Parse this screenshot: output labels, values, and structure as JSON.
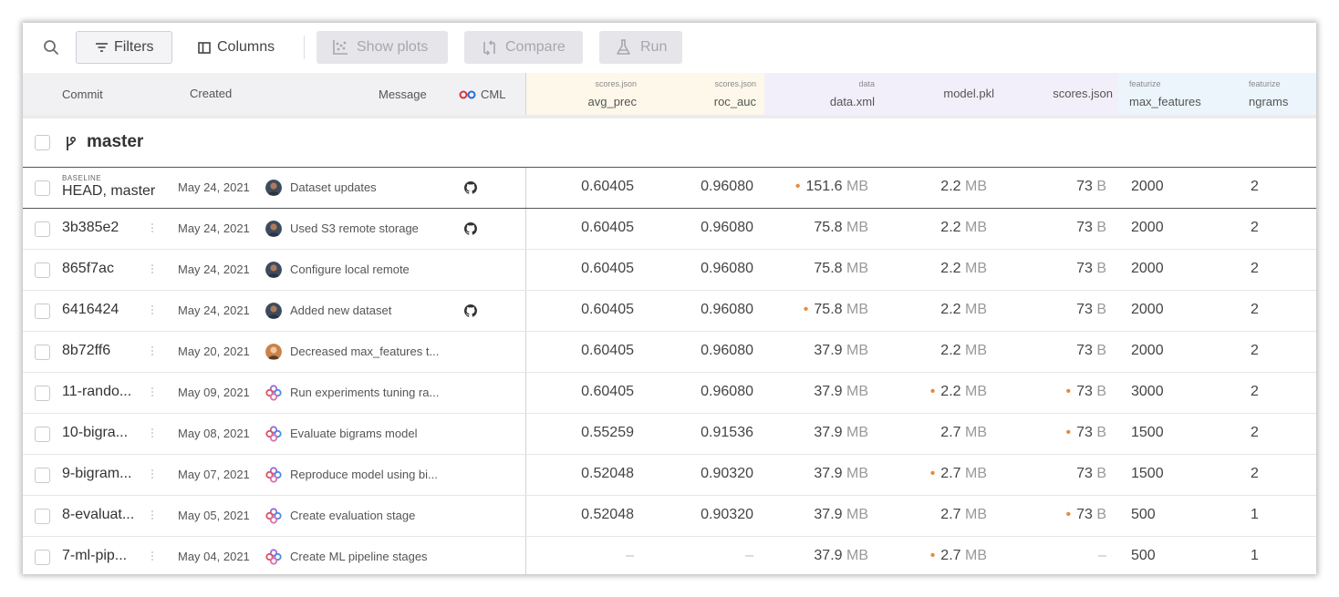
{
  "toolbar": {
    "filters_label": "Filters",
    "columns_label": "Columns",
    "show_plots_label": "Show plots",
    "compare_label": "Compare",
    "run_label": "Run"
  },
  "header": {
    "commit": "Commit",
    "created": "Created",
    "message": "Message",
    "cml": "CML",
    "avg_prec": {
      "source": "scores.json",
      "name": "avg_prec"
    },
    "roc_auc": {
      "source": "scores.json",
      "name": "roc_auc"
    },
    "data_xml": {
      "source": "data",
      "name": "data.xml"
    },
    "model_pkl": {
      "name": "model.pkl"
    },
    "scores_json": {
      "name": "scores.json"
    },
    "max_features": {
      "source": "featurize",
      "name": "max_features"
    },
    "ngrams": {
      "source": "featurize",
      "name": "ngrams"
    }
  },
  "branch": {
    "name": "master",
    "icon": "git-branch-icon"
  },
  "rows": [
    {
      "tag": "BASELINE",
      "commit": "HEAD, master",
      "created": "May 24, 2021",
      "avatar": "user-photo",
      "message": "Dataset updates",
      "cml": true,
      "avg_prec": "0.60405",
      "roc_auc": "0.96080",
      "data_xml": {
        "value": "151.6",
        "unit": "MB",
        "modified": true
      },
      "model_pkl": {
        "value": "2.2",
        "unit": "MB",
        "modified": false
      },
      "scores_json": {
        "value": "73",
        "unit": "B",
        "modified": false
      },
      "max_features": "2000",
      "ngrams": "2"
    },
    {
      "commit": "3b385e2",
      "created": "May 24, 2021",
      "avatar": "user-photo",
      "message": "Used S3 remote storage",
      "cml": true,
      "avg_prec": "0.60405",
      "roc_auc": "0.96080",
      "data_xml": {
        "value": "75.8",
        "unit": "MB",
        "modified": false
      },
      "model_pkl": {
        "value": "2.2",
        "unit": "MB",
        "modified": false
      },
      "scores_json": {
        "value": "73",
        "unit": "B",
        "modified": false
      },
      "max_features": "2000",
      "ngrams": "2"
    },
    {
      "commit": "865f7ac",
      "created": "May 24, 2021",
      "avatar": "user-photo",
      "message": "Configure local remote",
      "cml": false,
      "avg_prec": "0.60405",
      "roc_auc": "0.96080",
      "data_xml": {
        "value": "75.8",
        "unit": "MB",
        "modified": false
      },
      "model_pkl": {
        "value": "2.2",
        "unit": "MB",
        "modified": false
      },
      "scores_json": {
        "value": "73",
        "unit": "B",
        "modified": false
      },
      "max_features": "2000",
      "ngrams": "2"
    },
    {
      "commit": "6416424",
      "created": "May 24, 2021",
      "avatar": "user-photo",
      "message": "Added new dataset",
      "cml": true,
      "avg_prec": "0.60405",
      "roc_auc": "0.96080",
      "data_xml": {
        "value": "75.8",
        "unit": "MB",
        "modified": true
      },
      "model_pkl": {
        "value": "2.2",
        "unit": "MB",
        "modified": false
      },
      "scores_json": {
        "value": "73",
        "unit": "B",
        "modified": false
      },
      "max_features": "2000",
      "ngrams": "2"
    },
    {
      "commit": "8b72ff6",
      "created": "May 20, 2021",
      "avatar": "user-photo-2",
      "message": "Decreased max_features t...",
      "cml": false,
      "avg_prec": "0.60405",
      "roc_auc": "0.96080",
      "data_xml": {
        "value": "37.9",
        "unit": "MB",
        "modified": false
      },
      "model_pkl": {
        "value": "2.2",
        "unit": "MB",
        "modified": false
      },
      "scores_json": {
        "value": "73",
        "unit": "B",
        "modified": false
      },
      "max_features": "2000",
      "ngrams": "2"
    },
    {
      "commit": "11-rando...",
      "created": "May 09, 2021",
      "avatar": "dvc-bot",
      "message": "Run experiments tuning ra...",
      "cml": false,
      "avg_prec": "0.60405",
      "roc_auc": "0.96080",
      "data_xml": {
        "value": "37.9",
        "unit": "MB",
        "modified": false
      },
      "model_pkl": {
        "value": "2.2",
        "unit": "MB",
        "modified": true
      },
      "scores_json": {
        "value": "73",
        "unit": "B",
        "modified": true
      },
      "max_features": "3000",
      "ngrams": "2"
    },
    {
      "commit": "10-bigra...",
      "created": "May 08, 2021",
      "avatar": "dvc-bot",
      "message": "Evaluate bigrams model",
      "cml": false,
      "avg_prec": "0.55259",
      "roc_auc": "0.91536",
      "data_xml": {
        "value": "37.9",
        "unit": "MB",
        "modified": false
      },
      "model_pkl": {
        "value": "2.7",
        "unit": "MB",
        "modified": false
      },
      "scores_json": {
        "value": "73",
        "unit": "B",
        "modified": true
      },
      "max_features": "1500",
      "ngrams": "2"
    },
    {
      "commit": "9-bigram...",
      "created": "May 07, 2021",
      "avatar": "dvc-bot",
      "message": "Reproduce model using bi...",
      "cml": false,
      "avg_prec": "0.52048",
      "roc_auc": "0.90320",
      "data_xml": {
        "value": "37.9",
        "unit": "MB",
        "modified": false
      },
      "model_pkl": {
        "value": "2.7",
        "unit": "MB",
        "modified": true
      },
      "scores_json": {
        "value": "73",
        "unit": "B",
        "modified": false
      },
      "max_features": "1500",
      "ngrams": "2"
    },
    {
      "commit": "8-evaluat...",
      "created": "May 05, 2021",
      "avatar": "dvc-bot",
      "message": "Create evaluation stage",
      "cml": false,
      "avg_prec": "0.52048",
      "roc_auc": "0.90320",
      "data_xml": {
        "value": "37.9",
        "unit": "MB",
        "modified": false
      },
      "model_pkl": {
        "value": "2.7",
        "unit": "MB",
        "modified": false
      },
      "scores_json": {
        "value": "73",
        "unit": "B",
        "modified": true
      },
      "max_features": "500",
      "ngrams": "1"
    },
    {
      "commit": "7-ml-pip...",
      "created": "May 04, 2021",
      "avatar": "dvc-bot",
      "message": "Create ML pipeline stages",
      "cml": false,
      "avg_prec": "–",
      "roc_auc": "–",
      "data_xml": {
        "value": "37.9",
        "unit": "MB",
        "modified": false
      },
      "model_pkl": {
        "value": "2.7",
        "unit": "MB",
        "modified": true
      },
      "scores_json": {
        "value": "–",
        "unit": "",
        "modified": false
      },
      "max_features": "500",
      "ngrams": "1"
    }
  ],
  "colors": {
    "modified_dot": "#e8893a",
    "metrics_header_bg": "#fdf8ea",
    "deps_header_bg": "#f3effa",
    "params_header_bg": "#ecf5fb"
  }
}
